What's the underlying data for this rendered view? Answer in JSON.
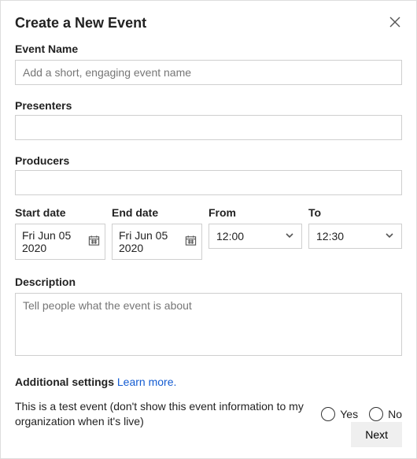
{
  "dialog": {
    "title": "Create a New Event"
  },
  "eventName": {
    "label": "Event Name",
    "placeholder": "Add a short, engaging event name",
    "value": ""
  },
  "presenters": {
    "label": "Presenters",
    "value": ""
  },
  "producers": {
    "label": "Producers",
    "value": ""
  },
  "schedule": {
    "startDateLabel": "Start date",
    "startDate": "Fri Jun 05 2020",
    "endDateLabel": "End date",
    "endDate": "Fri Jun 05 2020",
    "fromLabel": "From",
    "fromTime": "12:00",
    "toLabel": "To",
    "toTime": "12:30"
  },
  "description": {
    "label": "Description",
    "placeholder": "Tell people what the event is about",
    "value": ""
  },
  "settings": {
    "heading": "Additional settings",
    "learnMore": "Learn more.",
    "testEventText": "This is a test event (don't show this event information to my organization when it's live)",
    "yesLabel": "Yes",
    "noLabel": "No"
  },
  "footer": {
    "nextLabel": "Next"
  }
}
